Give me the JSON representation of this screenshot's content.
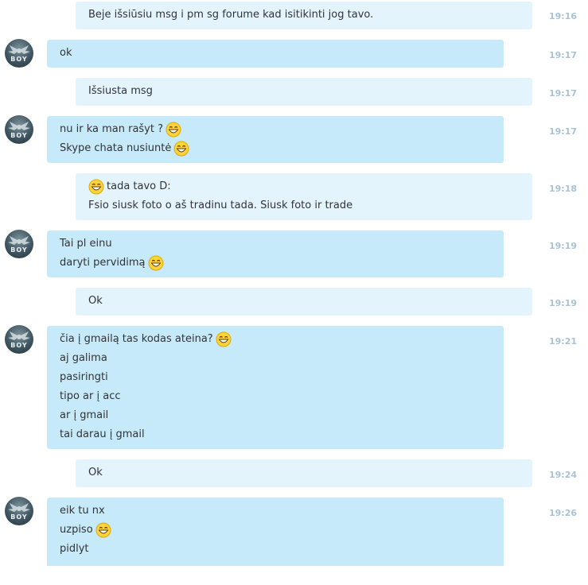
{
  "avatar_text": "BOY",
  "emoticon": "laughing-face-icon",
  "colors": {
    "outgoing_bg": "#e4f4fc",
    "incoming_bg": "#c7eafb",
    "time": "#a9c3d3"
  },
  "messages": [
    {
      "dir": "out",
      "time": "19:16",
      "lines": [
        "Beje išsiūsiu msg i pm sg forume kad isitikinti jog tavo."
      ]
    },
    {
      "dir": "in",
      "time": "19:17",
      "lines": [
        "ok"
      ]
    },
    {
      "dir": "out",
      "time": "19:17",
      "lines": [
        "Išsiusta msg"
      ]
    },
    {
      "dir": "in",
      "time": "19:17",
      "lines": [
        "nu ir ka man rašyt ?",
        "Skype chata nusiuntė"
      ]
    },
    {
      "dir": "out",
      "time": "19:18",
      "lines": [
        "tada tavo D:",
        "Fsio siusk foto o aš tradinu tada. Siusk foto ir trade"
      ]
    },
    {
      "dir": "in",
      "time": "19:19",
      "lines": [
        "Tai pl einu",
        "daryti pervidimą"
      ]
    },
    {
      "dir": "out",
      "time": "19:19",
      "lines": [
        "Ok"
      ]
    },
    {
      "dir": "in",
      "time": "19:21",
      "lines": [
        "čia į gmailą tas kodas ateina?",
        "aj galima",
        "pasiringti",
        "tipo ar į acc",
        "ar į gmail",
        "tai darau į gmail"
      ]
    },
    {
      "dir": "out",
      "time": "19:24",
      "lines": [
        "Ok"
      ]
    },
    {
      "dir": "in",
      "time": "19:26",
      "lines": [
        "eik tu nx",
        "uzpiso",
        "pidlyt"
      ]
    }
  ]
}
